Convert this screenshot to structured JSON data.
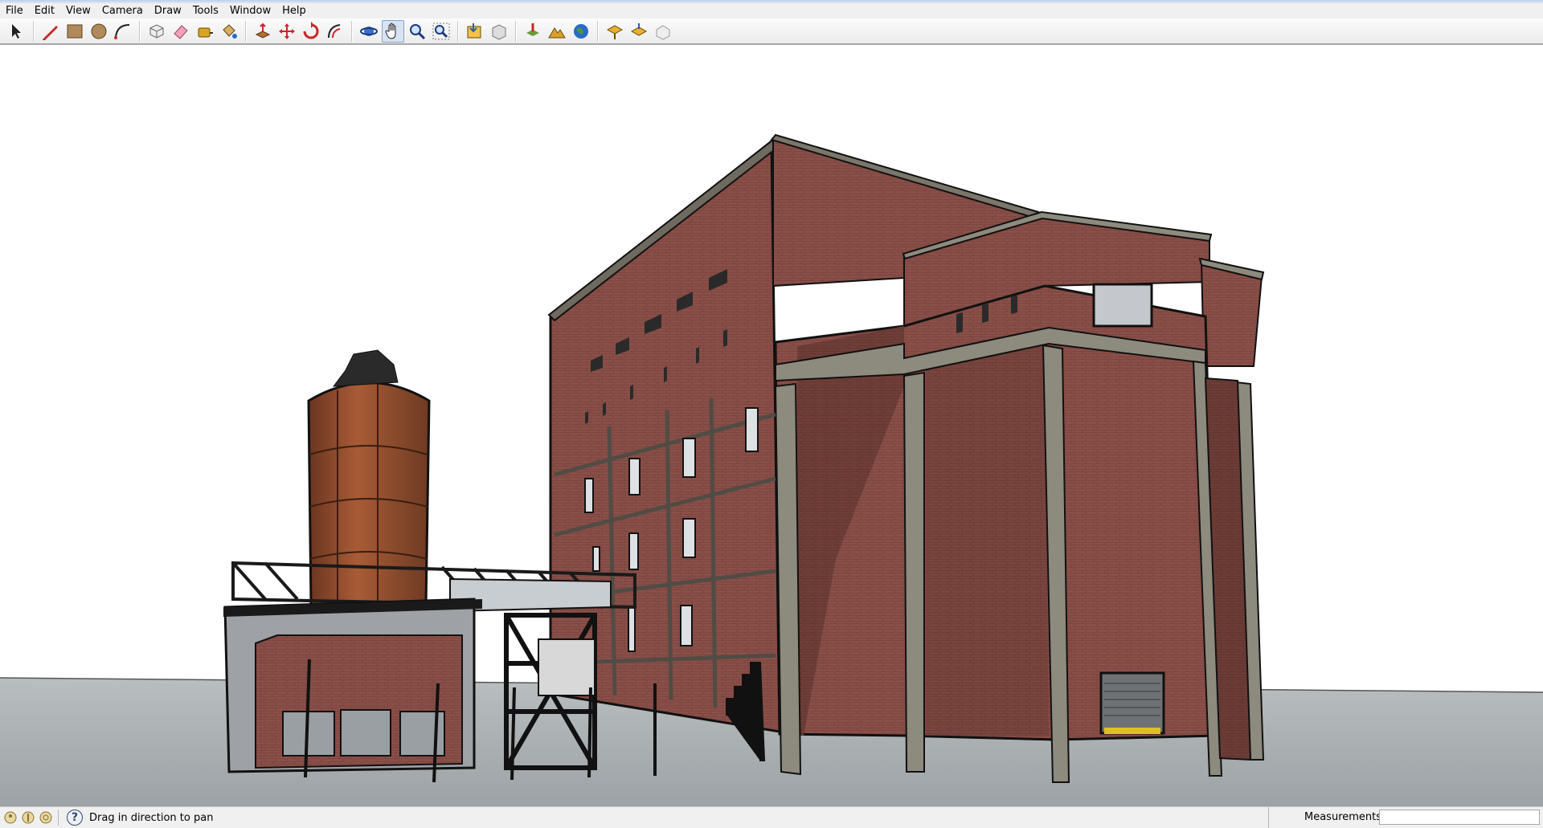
{
  "menu": {
    "items": [
      {
        "label": "File"
      },
      {
        "label": "Edit"
      },
      {
        "label": "View"
      },
      {
        "label": "Camera"
      },
      {
        "label": "Draw"
      },
      {
        "label": "Tools"
      },
      {
        "label": "Window"
      },
      {
        "label": "Help"
      }
    ]
  },
  "toolbar": {
    "groups": [
      [
        "select-icon"
      ],
      [
        "pencil-line-icon",
        "rectangle-icon",
        "circle-icon",
        "arc-icon"
      ],
      [
        "make-component-icon",
        "eraser-icon",
        "tape-measure-icon",
        "paint-bucket-icon"
      ],
      [
        "push-pull-icon",
        "move-icon",
        "rotate-icon",
        "offset-icon"
      ],
      [
        "orbit-icon",
        "pan-icon",
        "zoom-icon",
        "zoom-extents-icon"
      ],
      [
        "get-models-icon",
        "share-model-icon"
      ],
      [
        "add-location-icon",
        "toggle-terrain-icon",
        "preview-in-google-earth-icon"
      ],
      [
        "get-models-warehouse-icon",
        "share-component-icon",
        "extension-warehouse-icon"
      ]
    ],
    "active_tool": "pan-icon"
  },
  "status": {
    "hint": "Drag in direction to pan",
    "measurements_label": "Measurements",
    "measurements_value": ""
  },
  "colors": {
    "accent": "#2a5fa8",
    "brick": "#8a4f48",
    "concrete": "#8d8a7e",
    "ground": "#a7adb0",
    "silo": "#9a5432"
  }
}
